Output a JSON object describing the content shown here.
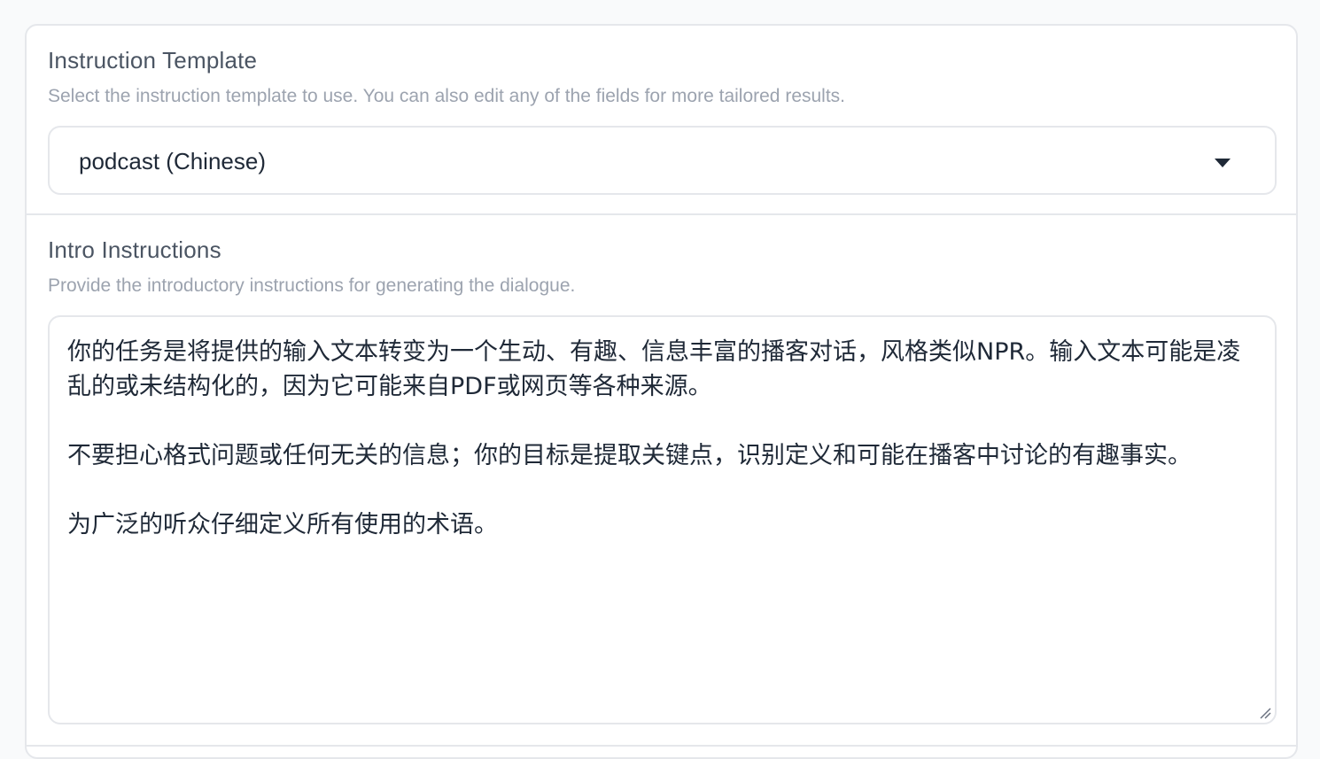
{
  "instruction_template": {
    "label": "Instruction Template",
    "info": "Select the instruction template to use. You can also edit any of the fields for more tailored results.",
    "selected": "podcast (Chinese)"
  },
  "intro_instructions": {
    "label": "Intro Instructions",
    "info": "Provide the introductory instructions for generating the dialogue.",
    "paragraphs": [
      "你的任务是将提供的输入文本转变为一个生动、有趣、信息丰富的播客对话，风格类似NPR。输入文本可能是凌乱的或未结构化的，因为它可能来自PDF或网页等各种来源。",
      "不要担心格式问题或任何无关的信息；你的目标是提取关键点，识别定义和可能在播客中讨论的有趣事实。",
      "为广泛的听众仔细定义所有使用的术语。"
    ]
  }
}
